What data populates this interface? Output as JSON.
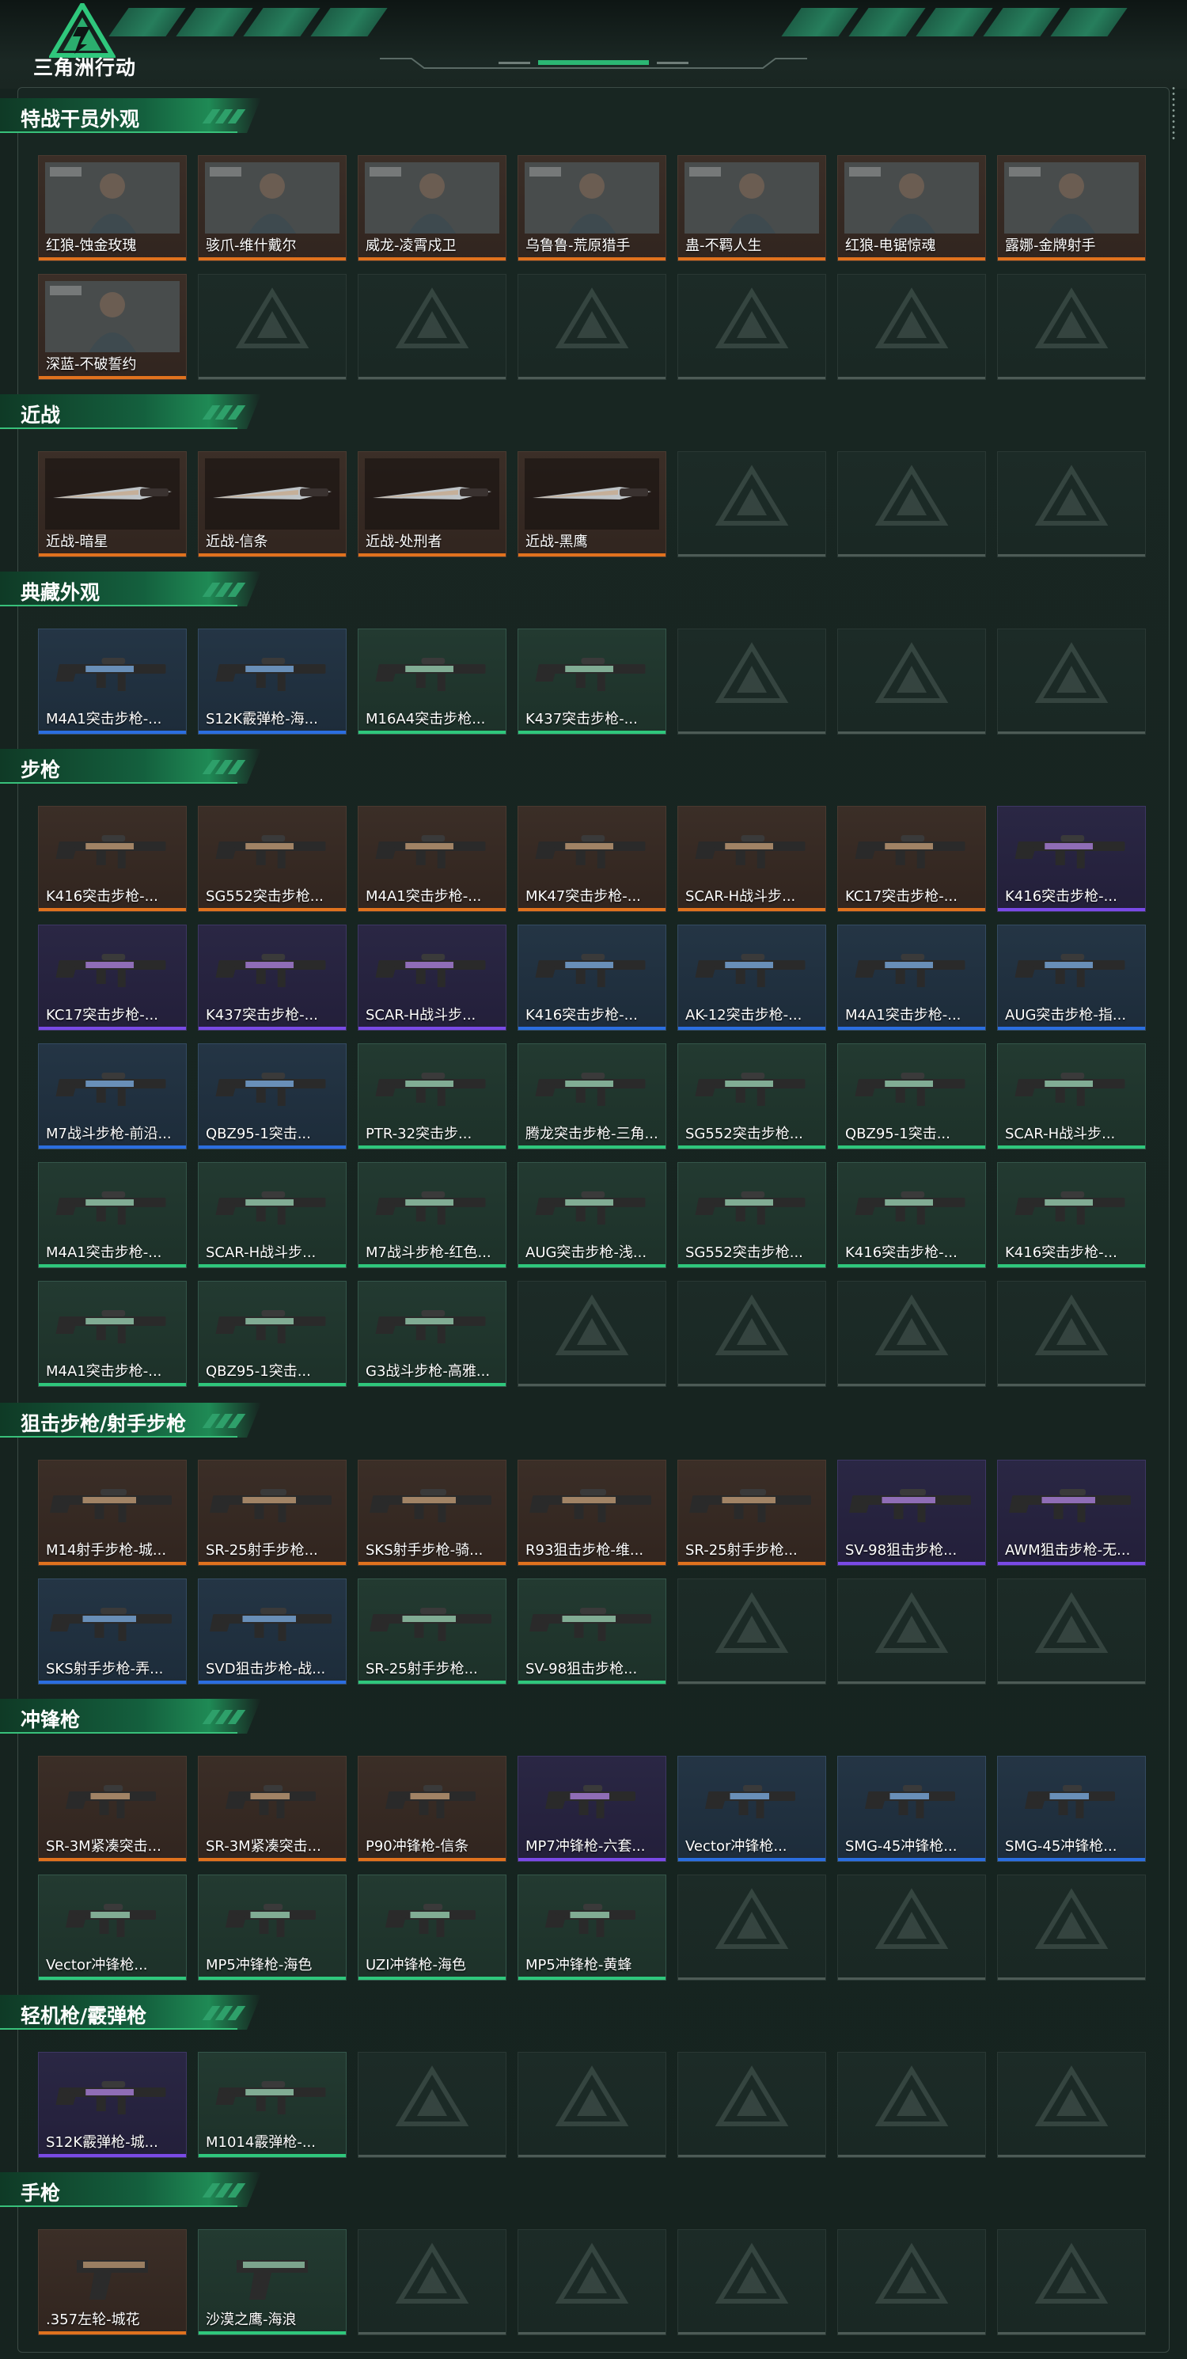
{
  "header": {
    "logo_text": "三角洲行动",
    "logo_icon": "delta-triangle-icon",
    "colors": {
      "accent": "#2fc77c",
      "background": "#16231f"
    }
  },
  "rarity_colors": {
    "orange": "#e0721e",
    "purple": "#7a4ae6",
    "blue": "#2b6ee0",
    "green": "#2fc77c",
    "empty": "#6f7d78"
  },
  "sections": [
    {
      "title": "特战干员外观",
      "rows": 2,
      "items": [
        {
          "label": "红狼-蚀金玫瑰",
          "rarity": "orange",
          "kind": "operator"
        },
        {
          "label": "骇爪-维什戴尔",
          "rarity": "orange",
          "kind": "operator"
        },
        {
          "label": "威龙-凌霄戍卫",
          "rarity": "orange",
          "kind": "operator"
        },
        {
          "label": "乌鲁鲁-荒原猎手",
          "rarity": "orange",
          "kind": "operator"
        },
        {
          "label": "蛊-不羁人生",
          "rarity": "orange",
          "kind": "operator"
        },
        {
          "label": "红狼-电锯惊魂",
          "rarity": "orange",
          "kind": "operator"
        },
        {
          "label": "露娜-金牌射手",
          "rarity": "orange",
          "kind": "operator"
        },
        {
          "label": "深蓝-不破誓约",
          "rarity": "orange",
          "kind": "operator"
        }
      ]
    },
    {
      "title": "近战",
      "rows": 1,
      "items": [
        {
          "label": "近战-暗星",
          "rarity": "orange",
          "kind": "knife"
        },
        {
          "label": "近战-信条",
          "rarity": "orange",
          "kind": "knife"
        },
        {
          "label": "近战-处刑者",
          "rarity": "orange",
          "kind": "knife"
        },
        {
          "label": "近战-黑鹰",
          "rarity": "orange",
          "kind": "knife"
        }
      ]
    },
    {
      "title": "典藏外观",
      "rows": 1,
      "items": [
        {
          "label": "M4A1突击步枪-...",
          "rarity": "blue",
          "kind": "rifle"
        },
        {
          "label": "S12K霰弹枪-海...",
          "rarity": "blue",
          "kind": "rifle"
        },
        {
          "label": "M16A4突击步枪...",
          "rarity": "green",
          "kind": "rifle"
        },
        {
          "label": "K437突击步枪-...",
          "rarity": "green",
          "kind": "rifle"
        }
      ]
    },
    {
      "title": "步枪",
      "rows": 5,
      "items": [
        {
          "label": "K416突击步枪-...",
          "rarity": "orange",
          "kind": "rifle"
        },
        {
          "label": "SG552突击步枪...",
          "rarity": "orange",
          "kind": "rifle"
        },
        {
          "label": "M4A1突击步枪-...",
          "rarity": "orange",
          "kind": "rifle"
        },
        {
          "label": "MK47突击步枪-...",
          "rarity": "orange",
          "kind": "rifle"
        },
        {
          "label": "SCAR-H战斗步...",
          "rarity": "orange",
          "kind": "rifle"
        },
        {
          "label": "KC17突击步枪-...",
          "rarity": "orange",
          "kind": "rifle"
        },
        {
          "label": "K416突击步枪-...",
          "rarity": "purple",
          "kind": "rifle"
        },
        {
          "label": "KC17突击步枪-...",
          "rarity": "purple",
          "kind": "rifle"
        },
        {
          "label": "K437突击步枪-...",
          "rarity": "purple",
          "kind": "rifle"
        },
        {
          "label": "SCAR-H战斗步...",
          "rarity": "purple",
          "kind": "rifle"
        },
        {
          "label": "K416突击步枪-...",
          "rarity": "blue",
          "kind": "rifle"
        },
        {
          "label": "AK-12突击步枪-...",
          "rarity": "blue",
          "kind": "rifle"
        },
        {
          "label": "M4A1突击步枪-...",
          "rarity": "blue",
          "kind": "rifle"
        },
        {
          "label": "AUG突击步枪-指...",
          "rarity": "blue",
          "kind": "rifle"
        },
        {
          "label": "M7战斗步枪-前沿...",
          "rarity": "blue",
          "kind": "rifle"
        },
        {
          "label": "QBZ95-1突击...",
          "rarity": "blue",
          "kind": "rifle"
        },
        {
          "label": "PTR-32突击步...",
          "rarity": "green",
          "kind": "rifle"
        },
        {
          "label": "腾龙突击步枪-三角...",
          "rarity": "green",
          "kind": "rifle"
        },
        {
          "label": "SG552突击步枪...",
          "rarity": "green",
          "kind": "rifle"
        },
        {
          "label": "QBZ95-1突击...",
          "rarity": "green",
          "kind": "rifle"
        },
        {
          "label": "SCAR-H战斗步...",
          "rarity": "green",
          "kind": "rifle"
        },
        {
          "label": "M4A1突击步枪-...",
          "rarity": "green",
          "kind": "rifle"
        },
        {
          "label": "SCAR-H战斗步...",
          "rarity": "green",
          "kind": "rifle"
        },
        {
          "label": "M7战斗步枪-红色...",
          "rarity": "green",
          "kind": "rifle"
        },
        {
          "label": "AUG突击步枪-浅...",
          "rarity": "green",
          "kind": "rifle"
        },
        {
          "label": "SG552突击步枪...",
          "rarity": "green",
          "kind": "rifle"
        },
        {
          "label": "K416突击步枪-...",
          "rarity": "green",
          "kind": "rifle"
        },
        {
          "label": "K416突击步枪-...",
          "rarity": "green",
          "kind": "rifle"
        },
        {
          "label": "M4A1突击步枪-...",
          "rarity": "green",
          "kind": "rifle"
        },
        {
          "label": "QBZ95-1突击...",
          "rarity": "green",
          "kind": "rifle"
        },
        {
          "label": "G3战斗步枪-高雅...",
          "rarity": "green",
          "kind": "rifle"
        }
      ]
    },
    {
      "title": "狙击步枪/射手步枪",
      "rows": 2,
      "items": [
        {
          "label": "M14射手步枪-城...",
          "rarity": "orange",
          "kind": "sniper"
        },
        {
          "label": "SR-25射手步枪...",
          "rarity": "orange",
          "kind": "sniper"
        },
        {
          "label": "SKS射手步枪-骑...",
          "rarity": "orange",
          "kind": "sniper"
        },
        {
          "label": "R93狙击步枪-维...",
          "rarity": "orange",
          "kind": "sniper"
        },
        {
          "label": "SR-25射手步枪...",
          "rarity": "orange",
          "kind": "sniper"
        },
        {
          "label": "SV-98狙击步枪...",
          "rarity": "purple",
          "kind": "sniper"
        },
        {
          "label": "AWM狙击步枪-无...",
          "rarity": "purple",
          "kind": "sniper"
        },
        {
          "label": "SKS射手步枪-弄...",
          "rarity": "blue",
          "kind": "sniper"
        },
        {
          "label": "SVD狙击步枪-战...",
          "rarity": "blue",
          "kind": "sniper"
        },
        {
          "label": "SR-25射手步枪...",
          "rarity": "green",
          "kind": "sniper"
        },
        {
          "label": "SV-98狙击步枪...",
          "rarity": "green",
          "kind": "sniper"
        }
      ]
    },
    {
      "title": "冲锋枪",
      "rows": 2,
      "items": [
        {
          "label": "SR-3M紧凑突击...",
          "rarity": "orange",
          "kind": "smg"
        },
        {
          "label": "SR-3M紧凑突击...",
          "rarity": "orange",
          "kind": "smg"
        },
        {
          "label": "P90冲锋枪-信条",
          "rarity": "orange",
          "kind": "smg"
        },
        {
          "label": "MP7冲锋枪-六套...",
          "rarity": "purple",
          "kind": "smg"
        },
        {
          "label": "Vector冲锋枪...",
          "rarity": "blue",
          "kind": "smg"
        },
        {
          "label": "SMG-45冲锋枪...",
          "rarity": "blue",
          "kind": "smg"
        },
        {
          "label": "SMG-45冲锋枪...",
          "rarity": "blue",
          "kind": "smg"
        },
        {
          "label": "Vector冲锋枪...",
          "rarity": "green",
          "kind": "smg"
        },
        {
          "label": "MP5冲锋枪-海色",
          "rarity": "green",
          "kind": "smg"
        },
        {
          "label": "UZI冲锋枪-海色",
          "rarity": "green",
          "kind": "smg"
        },
        {
          "label": "MP5冲锋枪-黄蜂",
          "rarity": "green",
          "kind": "smg"
        }
      ]
    },
    {
      "title": "轻机枪/霰弹枪",
      "rows": 1,
      "items": [
        {
          "label": "S12K霰弹枪-城...",
          "rarity": "purple",
          "kind": "shotgun"
        },
        {
          "label": "M1014霰弹枪-...",
          "rarity": "green",
          "kind": "shotgun"
        }
      ]
    },
    {
      "title": "手枪",
      "rows": 1,
      "items": [
        {
          "label": ".357左轮-城花",
          "rarity": "orange",
          "kind": "pistol"
        },
        {
          "label": "沙漠之鹰-海浪",
          "rarity": "green",
          "kind": "pistol"
        }
      ]
    }
  ]
}
